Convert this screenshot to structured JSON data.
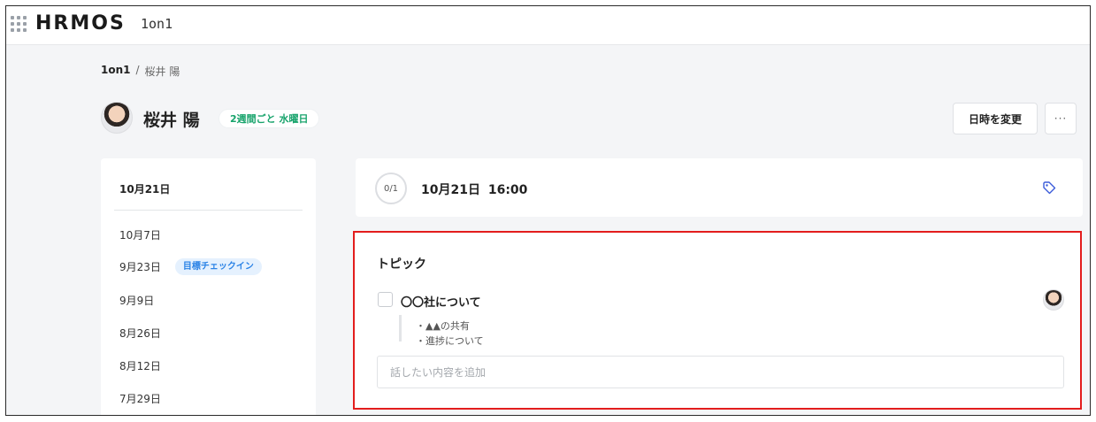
{
  "topbar": {
    "logo": "HRMOS",
    "product": "1on1",
    "apps_icon": "grid-dots-icon"
  },
  "breadcrumb": {
    "root": "1on1",
    "separator": "/",
    "current": "桜井 陽"
  },
  "header": {
    "name": "桜井 陽",
    "frequency": "2週間ごと 水曜日",
    "change_datetime_label": "日時を変更",
    "more_label": "···"
  },
  "sidebar": {
    "current_date": "10月21日",
    "items": [
      {
        "date": "10月7日"
      },
      {
        "date": "9月23日",
        "tag": "目標チェックイン"
      },
      {
        "date": "9月9日"
      },
      {
        "date": "8月26日"
      },
      {
        "date": "8月12日"
      },
      {
        "date": "7月29日"
      }
    ]
  },
  "meeting": {
    "progress": "0/1",
    "title": "10月21日 16:00",
    "tag_icon": "tag-icon"
  },
  "topics": {
    "heading": "トピック",
    "items": [
      {
        "title": "〇〇社について",
        "checked": false,
        "notes": [
          "・▲▲の共有",
          "・進捗について"
        ]
      }
    ],
    "add_placeholder": "話したい内容を追加"
  },
  "colors": {
    "accent_green": "#17a36b",
    "tag_blue": "#2b83e6",
    "highlight_red": "#e31d1d",
    "page_bg": "#f4f5f7"
  }
}
